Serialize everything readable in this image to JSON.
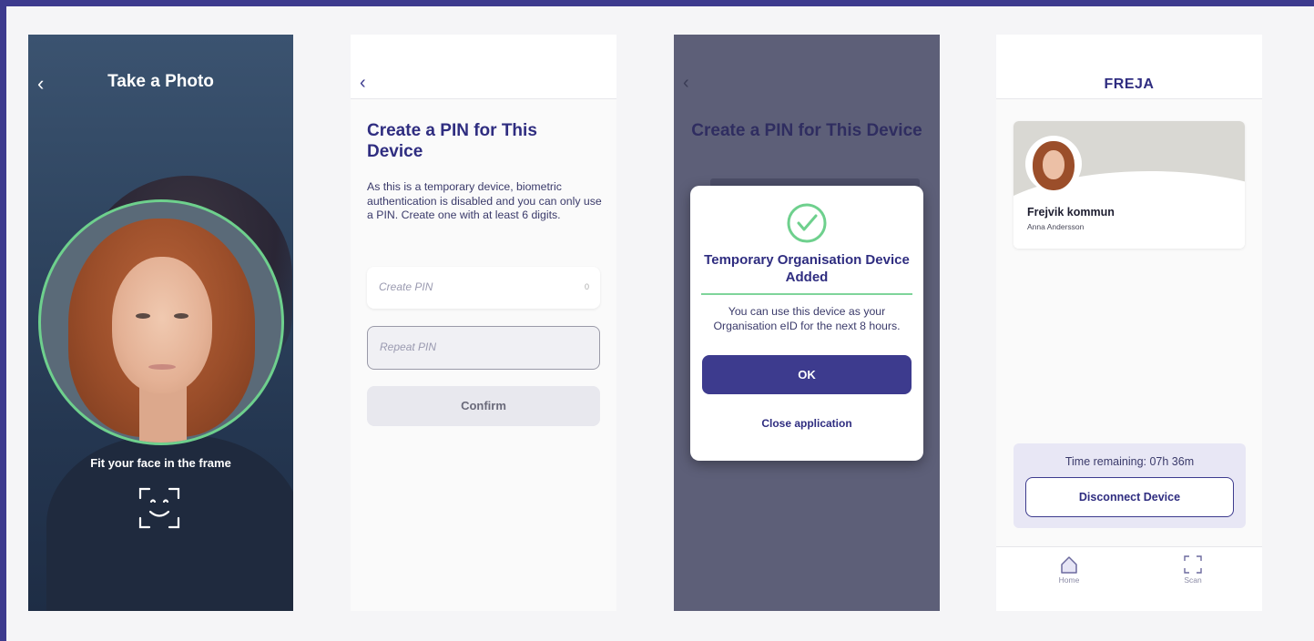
{
  "screen_photo": {
    "back_glyph": "‹",
    "title": "Take a Photo",
    "instruction": "Fit your face in the frame",
    "frame_color": "#6ed08d"
  },
  "screen_pin": {
    "back_glyph": "‹",
    "title": "Create a PIN for This Device",
    "description": "As this is a temporary device, biometric authentication is disabled and you can only use a PIN. Create one with at least 6 digits.",
    "create_pin_placeholder": "Create PIN",
    "create_pin_count": "0",
    "repeat_pin_placeholder": "Repeat PIN",
    "confirm_label": "Confirm"
  },
  "screen_dialog": {
    "back_glyph": "‹",
    "background_title": "Create a PIN for This Device",
    "dialog_title": "Temporary Organisation Device Added",
    "dialog_body": "You can use this device as your Organisation eID for the next 8 hours.",
    "ok_label": "OK",
    "close_label": "Close application",
    "accent_color": "#3d3b8e",
    "success_color": "#6ed08d"
  },
  "screen_home": {
    "brand": "FREJA",
    "card": {
      "organisation": "Frejvik kommun",
      "person": "Anna Andersson"
    },
    "time_remaining": "Time remaining: 07h 36m",
    "disconnect_label": "Disconnect Device",
    "tabs": [
      {
        "label": "Home",
        "icon": "home-icon"
      },
      {
        "label": "Scan",
        "icon": "scan-icon"
      }
    ]
  }
}
